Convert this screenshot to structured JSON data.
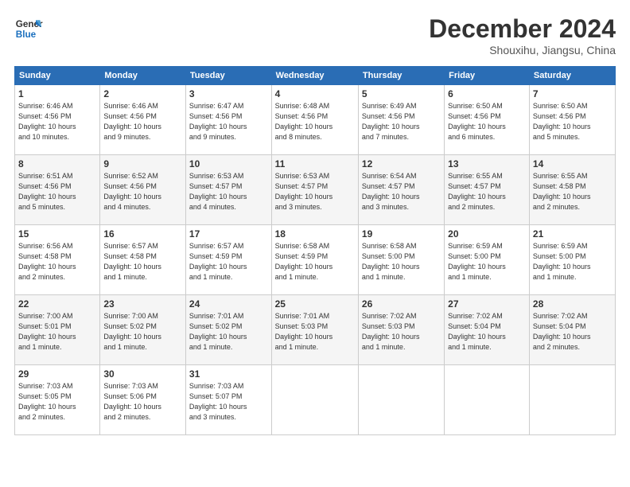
{
  "logo": {
    "line1": "General",
    "line2": "Blue"
  },
  "title": "December 2024",
  "location": "Shouxihu, Jiangsu, China",
  "days_of_week": [
    "Sunday",
    "Monday",
    "Tuesday",
    "Wednesday",
    "Thursday",
    "Friday",
    "Saturday"
  ],
  "weeks": [
    [
      {
        "day": "1",
        "info": "Sunrise: 6:46 AM\nSunset: 4:56 PM\nDaylight: 10 hours\nand 10 minutes."
      },
      {
        "day": "2",
        "info": "Sunrise: 6:46 AM\nSunset: 4:56 PM\nDaylight: 10 hours\nand 9 minutes."
      },
      {
        "day": "3",
        "info": "Sunrise: 6:47 AM\nSunset: 4:56 PM\nDaylight: 10 hours\nand 9 minutes."
      },
      {
        "day": "4",
        "info": "Sunrise: 6:48 AM\nSunset: 4:56 PM\nDaylight: 10 hours\nand 8 minutes."
      },
      {
        "day": "5",
        "info": "Sunrise: 6:49 AM\nSunset: 4:56 PM\nDaylight: 10 hours\nand 7 minutes."
      },
      {
        "day": "6",
        "info": "Sunrise: 6:50 AM\nSunset: 4:56 PM\nDaylight: 10 hours\nand 6 minutes."
      },
      {
        "day": "7",
        "info": "Sunrise: 6:50 AM\nSunset: 4:56 PM\nDaylight: 10 hours\nand 5 minutes."
      }
    ],
    [
      {
        "day": "8",
        "info": "Sunrise: 6:51 AM\nSunset: 4:56 PM\nDaylight: 10 hours\nand 5 minutes."
      },
      {
        "day": "9",
        "info": "Sunrise: 6:52 AM\nSunset: 4:56 PM\nDaylight: 10 hours\nand 4 minutes."
      },
      {
        "day": "10",
        "info": "Sunrise: 6:53 AM\nSunset: 4:57 PM\nDaylight: 10 hours\nand 4 minutes."
      },
      {
        "day": "11",
        "info": "Sunrise: 6:53 AM\nSunset: 4:57 PM\nDaylight: 10 hours\nand 3 minutes."
      },
      {
        "day": "12",
        "info": "Sunrise: 6:54 AM\nSunset: 4:57 PM\nDaylight: 10 hours\nand 3 minutes."
      },
      {
        "day": "13",
        "info": "Sunrise: 6:55 AM\nSunset: 4:57 PM\nDaylight: 10 hours\nand 2 minutes."
      },
      {
        "day": "14",
        "info": "Sunrise: 6:55 AM\nSunset: 4:58 PM\nDaylight: 10 hours\nand 2 minutes."
      }
    ],
    [
      {
        "day": "15",
        "info": "Sunrise: 6:56 AM\nSunset: 4:58 PM\nDaylight: 10 hours\nand 2 minutes."
      },
      {
        "day": "16",
        "info": "Sunrise: 6:57 AM\nSunset: 4:58 PM\nDaylight: 10 hours\nand 1 minute."
      },
      {
        "day": "17",
        "info": "Sunrise: 6:57 AM\nSunset: 4:59 PM\nDaylight: 10 hours\nand 1 minute."
      },
      {
        "day": "18",
        "info": "Sunrise: 6:58 AM\nSunset: 4:59 PM\nDaylight: 10 hours\nand 1 minute."
      },
      {
        "day": "19",
        "info": "Sunrise: 6:58 AM\nSunset: 5:00 PM\nDaylight: 10 hours\nand 1 minute."
      },
      {
        "day": "20",
        "info": "Sunrise: 6:59 AM\nSunset: 5:00 PM\nDaylight: 10 hours\nand 1 minute."
      },
      {
        "day": "21",
        "info": "Sunrise: 6:59 AM\nSunset: 5:00 PM\nDaylight: 10 hours\nand 1 minute."
      }
    ],
    [
      {
        "day": "22",
        "info": "Sunrise: 7:00 AM\nSunset: 5:01 PM\nDaylight: 10 hours\nand 1 minute."
      },
      {
        "day": "23",
        "info": "Sunrise: 7:00 AM\nSunset: 5:02 PM\nDaylight: 10 hours\nand 1 minute."
      },
      {
        "day": "24",
        "info": "Sunrise: 7:01 AM\nSunset: 5:02 PM\nDaylight: 10 hours\nand 1 minute."
      },
      {
        "day": "25",
        "info": "Sunrise: 7:01 AM\nSunset: 5:03 PM\nDaylight: 10 hours\nand 1 minute."
      },
      {
        "day": "26",
        "info": "Sunrise: 7:02 AM\nSunset: 5:03 PM\nDaylight: 10 hours\nand 1 minute."
      },
      {
        "day": "27",
        "info": "Sunrise: 7:02 AM\nSunset: 5:04 PM\nDaylight: 10 hours\nand 1 minute."
      },
      {
        "day": "28",
        "info": "Sunrise: 7:02 AM\nSunset: 5:04 PM\nDaylight: 10 hours\nand 2 minutes."
      }
    ],
    [
      {
        "day": "29",
        "info": "Sunrise: 7:03 AM\nSunset: 5:05 PM\nDaylight: 10 hours\nand 2 minutes."
      },
      {
        "day": "30",
        "info": "Sunrise: 7:03 AM\nSunset: 5:06 PM\nDaylight: 10 hours\nand 2 minutes."
      },
      {
        "day": "31",
        "info": "Sunrise: 7:03 AM\nSunset: 5:07 PM\nDaylight: 10 hours\nand 3 minutes."
      },
      {
        "day": "",
        "info": ""
      },
      {
        "day": "",
        "info": ""
      },
      {
        "day": "",
        "info": ""
      },
      {
        "day": "",
        "info": ""
      }
    ]
  ]
}
